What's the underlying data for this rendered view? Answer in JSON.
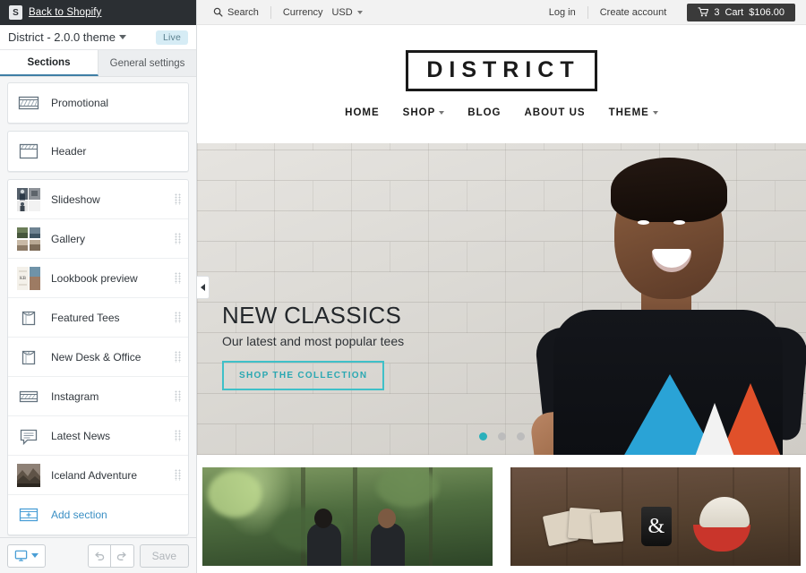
{
  "shopify_bar": {
    "back_label": "Back to Shopify",
    "logo_icon": "shopify-bag-icon"
  },
  "theme_bar": {
    "theme_name": "District - 2.0.0 theme",
    "chevron_icon": "chevron-down-icon",
    "live_badge": "Live"
  },
  "tabs": [
    {
      "label": "Sections",
      "active": true
    },
    {
      "label": "General settings",
      "active": false
    }
  ],
  "sections": {
    "groups": [
      {
        "items": [
          {
            "label": "Promotional",
            "icon": "promo-banner-icon",
            "draggable": false
          }
        ]
      },
      {
        "items": [
          {
            "label": "Header",
            "icon": "header-icon",
            "draggable": false
          }
        ]
      },
      {
        "items": [
          {
            "label": "Slideshow",
            "icon": "slideshow-thumb",
            "draggable": true
          },
          {
            "label": "Gallery",
            "icon": "gallery-thumb",
            "draggable": true
          },
          {
            "label": "Lookbook preview",
            "icon": "lookbook-thumb",
            "draggable": true
          },
          {
            "label": "Featured Tees",
            "icon": "product-tag-icon",
            "draggable": true
          },
          {
            "label": "New Desk & Office",
            "icon": "product-tag-icon",
            "draggable": true
          },
          {
            "label": "Instagram",
            "icon": "instagram-grid-icon",
            "draggable": true
          },
          {
            "label": "Latest News",
            "icon": "blog-comment-icon",
            "draggable": true
          },
          {
            "label": "Iceland Adventure",
            "icon": "iceland-thumb",
            "draggable": true
          },
          {
            "label": "Add section",
            "icon": "add-section-icon",
            "draggable": false,
            "is_add": true
          }
        ]
      }
    ]
  },
  "sidebar_footer": {
    "device_icon": "desktop-icon",
    "device_chevron_icon": "chevron-down-icon",
    "undo_icon": "undo-arrow-icon",
    "redo_icon": "redo-arrow-icon",
    "save_label": "Save",
    "save_enabled": false
  },
  "preview": {
    "collapse_icon": "triangle-left-icon",
    "store_topbar": {
      "search_icon": "magnifier-icon",
      "search_label": "Search",
      "currency_label": "Currency",
      "currency_value": "USD",
      "currency_caret_icon": "caret-down-icon",
      "login_label": "Log in",
      "create_account_label": "Create account",
      "cart_icon": "shopping-cart-icon",
      "cart_count": "3",
      "cart_word": "Cart",
      "cart_total": "$106.00"
    },
    "store_header": {
      "logo_text": "DISTRICT",
      "nav": [
        {
          "label": "HOME",
          "has_dropdown": false
        },
        {
          "label": "SHOP",
          "has_dropdown": true
        },
        {
          "label": "BLOG",
          "has_dropdown": false
        },
        {
          "label": "ABOUT US",
          "has_dropdown": false
        },
        {
          "label": "THEME",
          "has_dropdown": true
        }
      ]
    },
    "hero": {
      "title": "NEW CLASSICS",
      "subtitle": "Our latest and most popular tees",
      "cta_label": "SHOP THE COLLECTION",
      "slide_count": 3,
      "active_slide": 1,
      "image_alt": "Smiling man in black triangle-graphic tee against white brick wall"
    },
    "tiles": [
      {
        "alt": "Couple walking on a forest trail"
      },
      {
        "alt": "Coasters, ampersand mug and red cap on wooden table"
      }
    ]
  },
  "colors": {
    "accent_teal": "#2ab0bb",
    "shopify_dark": "#2b2f33",
    "link_blue": "#3a8fc4",
    "live_badge_bg": "#d6ecf5",
    "tee_blue": "#2aa3d6",
    "tee_red": "#e0502a"
  }
}
